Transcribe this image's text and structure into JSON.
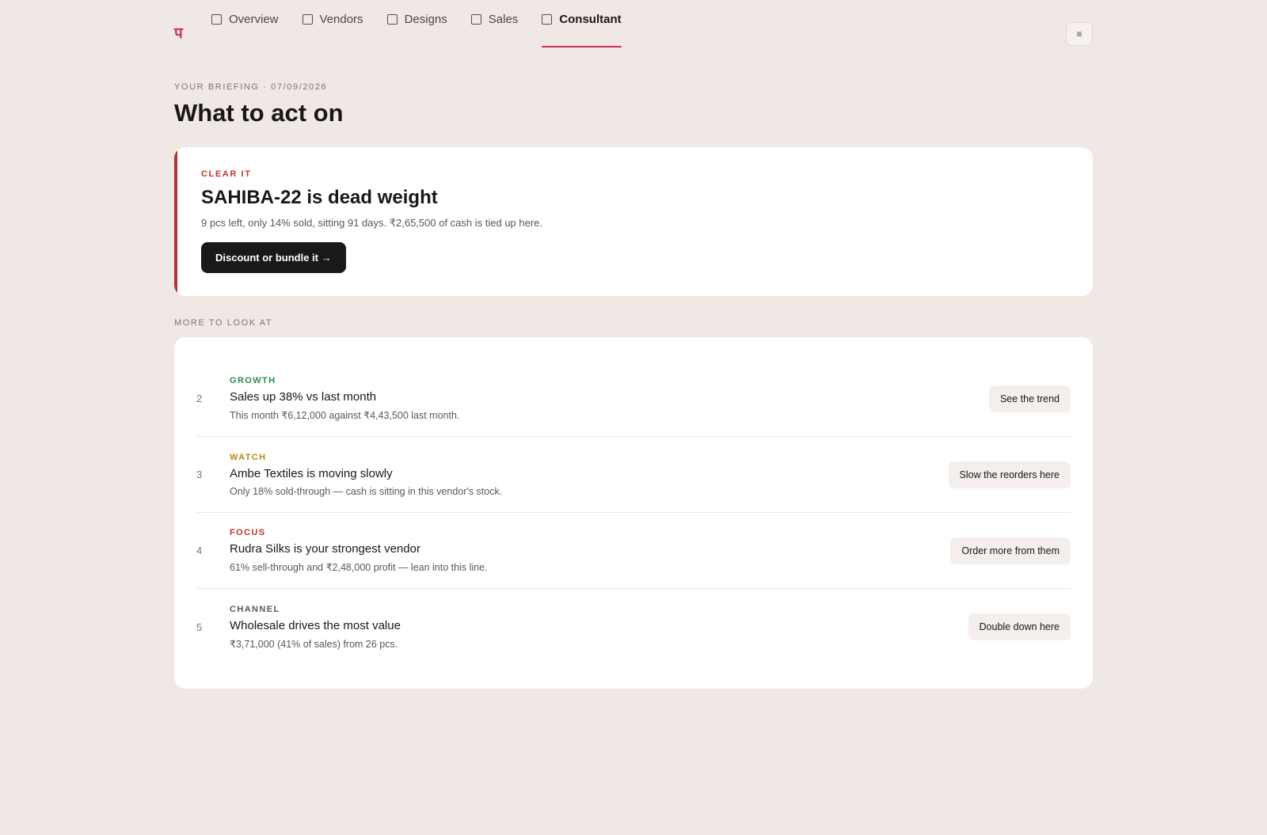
{
  "nav": {
    "logo": "प",
    "tabs": [
      {
        "label": "Overview"
      },
      {
        "label": "Vendors"
      },
      {
        "label": "Designs"
      },
      {
        "label": "Sales"
      },
      {
        "label": "Consultant"
      }
    ],
    "active_tab": "Consultant",
    "menu_icon": "≡"
  },
  "header": {
    "eyebrow": "YOUR BRIEFING · 07/09/2026",
    "title": "What to act on"
  },
  "hero": {
    "tag": "CLEAR IT",
    "title": "SAHIBA-22 is dead weight",
    "description": "9 pcs left, only 14% sold, sitting 91 days. ₹2,65,500 of cash is tied up here.",
    "button": "Discount or bundle it →",
    "accent_color": "#b8332c"
  },
  "more": {
    "label": "MORE TO LOOK AT",
    "items": [
      {
        "num": "2",
        "tag": "GROWTH",
        "tag_color": "#2e8a55",
        "title": "Sales up 38% vs last month",
        "description": "This month ₹6,12,000 against ₹4,43,500 last month.",
        "button": "See the trend"
      },
      {
        "num": "3",
        "tag": "WATCH",
        "tag_color": "#b78a12",
        "title": "Ambe Textiles is moving slowly",
        "description": "Only 18% sold-through — cash is sitting in this vendor's stock.",
        "button": "Slow the reorders here"
      },
      {
        "num": "4",
        "tag": "FOCUS",
        "tag_color": "#c0342d",
        "title": "Rudra Silks is your strongest vendor",
        "description": "61% sell-through and ₹2,48,000 profit — lean into this line.",
        "button": "Order more from them"
      },
      {
        "num": "5",
        "tag": "CHANNEL",
        "tag_color": "#5d5754",
        "title": "Wholesale drives the most value",
        "description": "₹3,71,000 (41% of sales) from 26 pcs.",
        "button": "Double down here"
      }
    ]
  }
}
